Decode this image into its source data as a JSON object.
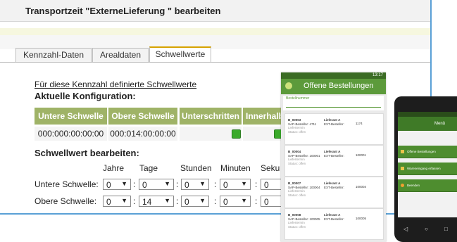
{
  "title": "Transportzeit \"ExterneLieferung \" bearbeiten",
  "tabs": [
    {
      "label": "Kennzahl-Daten"
    },
    {
      "label": "Arealdaten"
    },
    {
      "label": "Schwellwerte"
    }
  ],
  "link": "Für diese Kennzahl definierte Schwellwerte",
  "current_config": "Aktuelle Konfiguration:",
  "table": {
    "headers": [
      "Untere Schwelle",
      "Obere Schwelle",
      "Unterschritten",
      "Innerhalb"
    ],
    "row": [
      "000:000:00:00:00",
      "000:014:00:00:00"
    ]
  },
  "edit_heading": "Schwellwert bearbeiten:",
  "time_units": [
    "Jahre",
    "Tage",
    "Stunden",
    "Minuten",
    "Seku"
  ],
  "rows": [
    {
      "label": "Untere Schwelle:",
      "values": [
        "0",
        "0",
        "0",
        "0",
        "0"
      ]
    },
    {
      "label": "Obere Schwelle:",
      "values": [
        "0",
        "14",
        "0",
        "0",
        "0"
      ]
    }
  ],
  "colors": {
    "accent": "#9fb367",
    "tab_accent": "#d6a200",
    "status_green": "#3aaa2a"
  },
  "phone1": {
    "status": "13:17",
    "title": "Offene Bestellungen",
    "search_label": "Bestellnummer",
    "orders": [
      {
        "id": "B_00003",
        "supplier": "Lieferant A",
        "sap": "SAP-Bestellnr: 4711",
        "ext": "EXT-Bestellnr:",
        "num": "1174",
        "date": "Liefertermin",
        "status": "Status: offen"
      },
      {
        "id": "B_00004",
        "supplier": "Lieferant A",
        "sap": "SAP-Bestellnr: 100001",
        "ext": "EXT-Bestellnr:",
        "num": "100001",
        "date": "Liefertermin",
        "status": "Status: offen"
      },
      {
        "id": "B_00007",
        "supplier": "Lieferant A",
        "sap": "SAP-Bestellnr: 100004",
        "ext": "EXT-Bestellnr:",
        "num": "100004",
        "date": "Liefertermin",
        "status": "Status: offen"
      },
      {
        "id": "B_00008",
        "supplier": "Lieferant A",
        "sap": "SAP-Bestellnr: 100005",
        "ext": "EXT-Bestellnr:",
        "num": "100005",
        "date": "Liefertermin",
        "status": "Status: offen"
      }
    ]
  },
  "phone2": {
    "title": "Menü",
    "items": [
      "Offene Bestellungen",
      "Wareneingang erfassen",
      "Beenden"
    ]
  }
}
